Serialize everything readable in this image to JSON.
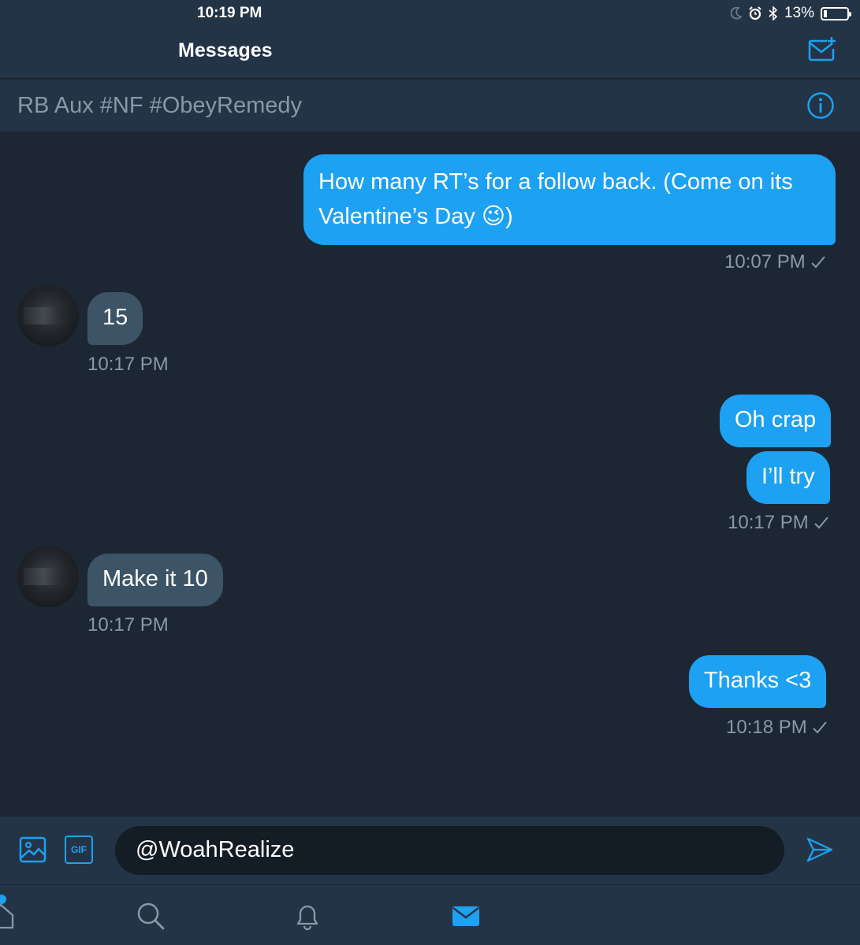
{
  "status_bar": {
    "time": "10:19 PM",
    "battery": "13%",
    "battery_level": 0.13
  },
  "nav": {
    "title": "Messages",
    "compose_icon": "compose-mail-icon"
  },
  "conversation": {
    "title": "RB Aux #NF #ObeyRemedy",
    "info_icon": "info-icon"
  },
  "messages": [
    {
      "dir": "out",
      "lines": [
        "How many RT’s for a follow back. (Come on its",
        "Valentine’s Day 😉)"
      ],
      "time": "10:07 PM"
    },
    {
      "dir": "in",
      "text": "15",
      "time": "10:17 PM"
    },
    {
      "dir": "out",
      "text": "Oh crap"
    },
    {
      "dir": "out",
      "text": "I’ll try",
      "time": "10:17 PM"
    },
    {
      "dir": "in",
      "text": "Make it 10",
      "time": "10:17 PM"
    },
    {
      "dir": "out",
      "text": "Thanks <3",
      "time": "10:18 PM"
    }
  ],
  "composer": {
    "value": "@WoahRealize",
    "image_icon": "image-icon",
    "gif_label": "GIF",
    "send_icon": "send-icon"
  },
  "tabs": [
    "home-icon",
    "search-icon",
    "notifications-icon",
    "messages-icon"
  ],
  "colors": {
    "accent": "#1da1f2",
    "background": "#1c2733",
    "bar": "#243447",
    "muted": "#8899a6",
    "incoming": "#3d5466"
  }
}
